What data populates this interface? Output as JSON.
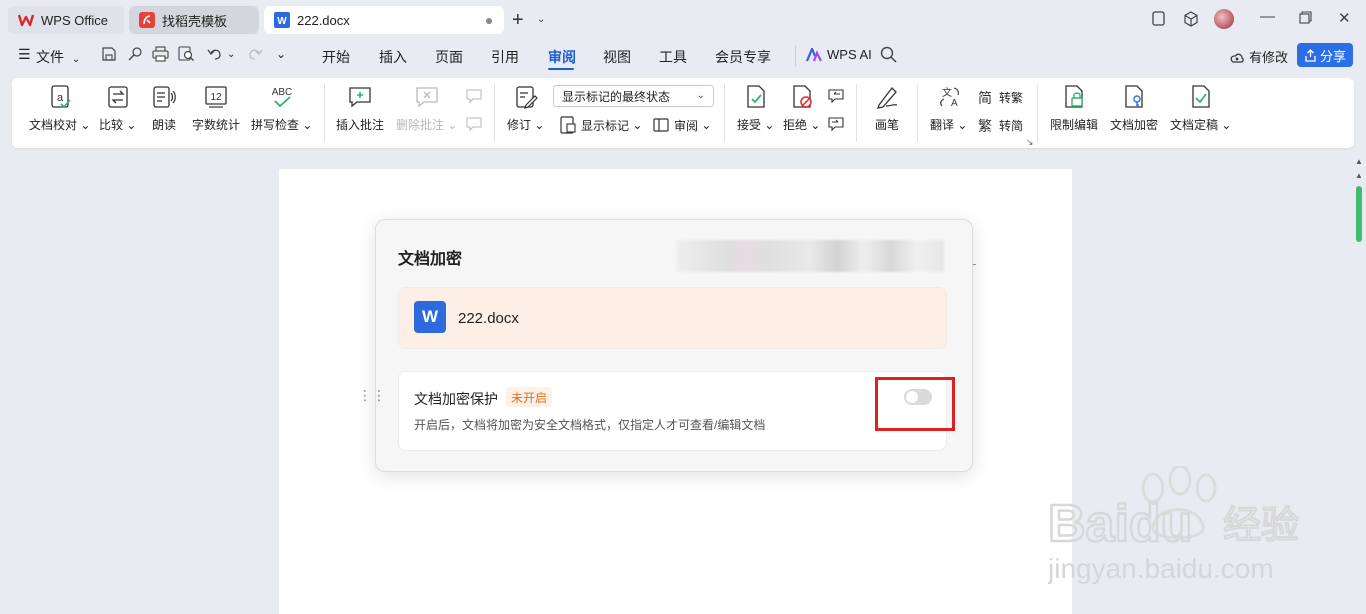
{
  "tabs": {
    "wps": "WPS Office",
    "template": "找稻壳模板",
    "doc": "222.docx"
  },
  "menu": {
    "file": "文件",
    "items": [
      "开始",
      "插入",
      "页面",
      "引用",
      "审阅",
      "视图",
      "工具",
      "会员专享"
    ],
    "active": "审阅",
    "ai": "WPS AI",
    "modified": "有修改",
    "share": "分享"
  },
  "ribbon": {
    "proofread": "文档校对",
    "compare": "比较",
    "read_aloud": "朗读",
    "word_count": "字数统计",
    "spell_check": "拼写检查",
    "insert_comment": "插入批注",
    "delete_comment": "删除批注",
    "track": "修订",
    "markup_state": "显示标记的最终状态",
    "show_markup": "显示标记",
    "review_pane": "审阅",
    "accept": "接受",
    "reject": "拒绝",
    "pen": "画笔",
    "translate": "翻译",
    "to_traditional": "转繁",
    "to_simplified": "转简",
    "restrict_edit": "限制编辑",
    "encrypt": "文档加密",
    "finalize": "文档定稿"
  },
  "dialog": {
    "title": "文档加密",
    "file_name": "222.docx",
    "setting_title": "文档加密保护",
    "status_badge": "未开启",
    "description": "开启后，文档将加密为安全文档格式，仅指定人才可查看/编辑文档",
    "toggle_on": false
  },
  "icons": {
    "word": "W",
    "spell_abc": "ABC",
    "count_12": "12"
  },
  "watermark": {
    "brand": "Baidu",
    "cn": "经验",
    "url": "jingyan.baidu.com"
  },
  "colors": {
    "accent": "#1a5fd6",
    "share_bg": "#2a6ee8",
    "highlight": "#e0201e",
    "badge": "#e0701c"
  }
}
